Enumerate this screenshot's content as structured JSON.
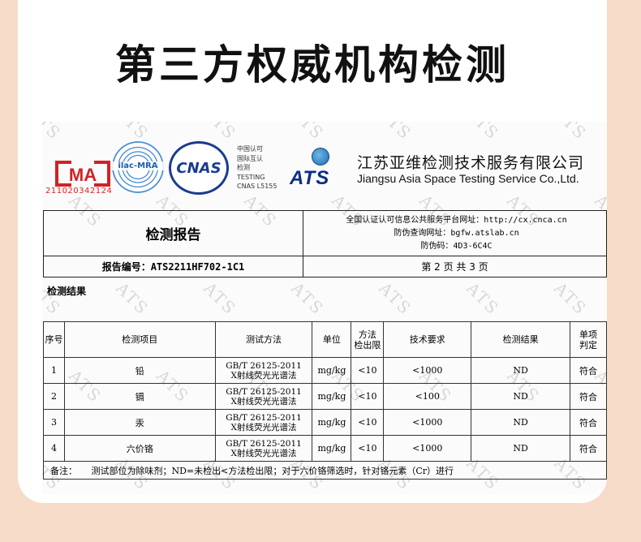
{
  "heading": "第三方权威机构检测",
  "watermark_text": "ATS",
  "logos": {
    "cma_text": "MA",
    "cma_number": "211020342124",
    "ilac_text": "ilac-MRA",
    "cnas_text": "CNAS",
    "cnas_lines": [
      "中国认可",
      "国际互认",
      "检测",
      "TESTING",
      "CNAS L5155"
    ],
    "ats_text": "ATS",
    "company_cn": "江苏亚维检测技术服务有限公司",
    "company_en": "Jiangsu Asia Space Testing Service Co.,Ltd."
  },
  "report": {
    "title": "检测报告",
    "info_lines": [
      "全国认证认可信息公共服务平台网址：http://cx.cnca.cn",
      "防伪查询网址：bgfw.atslab.cn",
      "防伪码：4D3-6C4C"
    ],
    "number": "报告编号：ATS2211HF702-1C1",
    "page": "第 2 页 共 3 页"
  },
  "results_label": "检测结果",
  "table": {
    "headers": [
      "序号",
      "检测项目",
      "测试方法",
      "单位",
      "方法\n检出限",
      "技术要求",
      "检测结果",
      "单项\n判定"
    ],
    "rows": [
      {
        "no": "1",
        "item": "铅",
        "method1": "GB/T 26125-2011",
        "method2": "X射线荧光光谱法",
        "unit": "mg/kg",
        "limit": "<10",
        "req": "<1000",
        "result": "ND",
        "judge": "符合"
      },
      {
        "no": "2",
        "item": "镉",
        "method1": "GB/T 26125-2011",
        "method2": "X射线荧光光谱法",
        "unit": "mg/kg",
        "limit": "<10",
        "req": "<100",
        "result": "ND",
        "judge": "符合"
      },
      {
        "no": "3",
        "item": "汞",
        "method1": "GB/T 26125-2011",
        "method2": "X射线荧光光谱法",
        "unit": "mg/kg",
        "limit": "<10",
        "req": "<1000",
        "result": "ND",
        "judge": "符合"
      },
      {
        "no": "4",
        "item": "六价铬",
        "method1": "GB/T 26125-2011",
        "method2": "X射线荧光光谱法",
        "unit": "mg/kg",
        "limit": "<10",
        "req": "<1000",
        "result": "ND",
        "judge": "符合"
      }
    ],
    "note": "备注：     测试部位为除味剂；ND=未检出<方法检出限；对于六价铬筛选时，针对铬元素（Cr）进行"
  },
  "colors": {
    "background": "#f6dcc8",
    "cma_red": "#d22222",
    "cnas_blue": "#1a3c8f",
    "ats_blue": "#0b2e85"
  }
}
